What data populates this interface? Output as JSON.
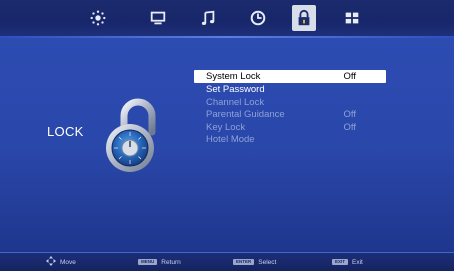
{
  "menu": {
    "tabs": [
      {
        "name": "picture-tab",
        "icon": "sun-icon"
      },
      {
        "name": "channel-tab",
        "icon": "monitor-icon"
      },
      {
        "name": "sound-tab",
        "icon": "music-note-icon"
      },
      {
        "name": "time-tab",
        "icon": "clock-icon"
      },
      {
        "name": "lock-tab",
        "icon": "padlock-icon",
        "active": true
      },
      {
        "name": "setup-tab",
        "icon": "grid-icon"
      }
    ]
  },
  "page": {
    "title": "LOCK"
  },
  "options": [
    {
      "label": "System Lock",
      "value": "Off",
      "selected": true,
      "enabled": true
    },
    {
      "label": "Set Password",
      "value": "",
      "selected": false,
      "enabled": true
    },
    {
      "label": "Channel Lock",
      "value": "",
      "selected": false,
      "enabled": false
    },
    {
      "label": "Parental Guidance",
      "value": "Off",
      "selected": false,
      "enabled": false
    },
    {
      "label": "Key Lock",
      "value": "Off",
      "selected": false,
      "enabled": false
    },
    {
      "label": "Hotel Mode",
      "value": "",
      "selected": false,
      "enabled": false
    }
  ],
  "footer": {
    "move_label": "Move",
    "menu_key": "MENU",
    "return_label": "Return",
    "enter_key": "ENTER",
    "select_label": "Select",
    "exit_key": "EXIT",
    "exit_label": "Exit"
  },
  "colors": {
    "background": "#2a47aa",
    "selected_row": "#ffffff",
    "disabled_text": "#8da1d6"
  }
}
